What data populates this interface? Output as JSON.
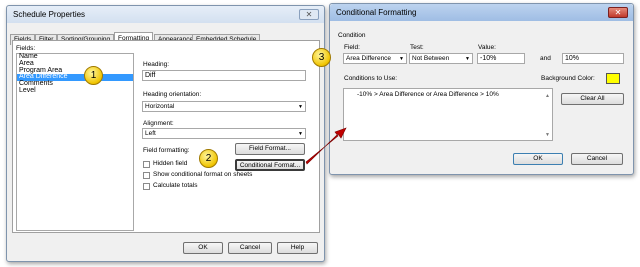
{
  "schedule": {
    "title": "Schedule Properties",
    "tabs": [
      "Fields",
      "Filter",
      "Sorting/Grouping",
      "Formatting",
      "Appearance",
      "Embedded Schedule"
    ],
    "fields_label": "Fields:",
    "fields": [
      "Name",
      "Area",
      "Program Area",
      "Area Difference",
      "Comments",
      "Level"
    ],
    "heading_label": "Heading:",
    "heading_value": "Diff",
    "orientation_label": "Heading orientation:",
    "orientation_value": "Horizontal",
    "alignment_label": "Alignment:",
    "alignment_value": "Left",
    "field_formatting_label": "Field formatting:",
    "field_format_button": "Field Format...",
    "conditional_format_button": "Conditional Format...",
    "hidden_field": "Hidden field",
    "show_conditional": "Show conditional format on sheets",
    "calculate_totals": "Calculate totals",
    "ok": "OK",
    "cancel": "Cancel",
    "help": "Help"
  },
  "conditional": {
    "title": "Conditional Formatting",
    "condition_label": "Condition",
    "field_label": "Field:",
    "field_value": "Area Difference",
    "test_label": "Test:",
    "test_value": "Not Between",
    "value_label": "Value:",
    "value1": "-10%",
    "and_label": "and",
    "value2": "10%",
    "conditions_label": "Conditions to Use:",
    "condition_item": "-10% > Area Difference or Area Difference > 10%",
    "bg_label": "Background Color:",
    "bg_color": "#ffff00",
    "clear_all": "Clear All",
    "ok": "OK",
    "cancel": "Cancel"
  },
  "callouts": [
    "1",
    "2",
    "3"
  ],
  "colors": {
    "title_active": "#d9e7f7",
    "title_dialog": "#a9c4e8",
    "selection": "#3399ff",
    "arrow": "#c00000"
  }
}
